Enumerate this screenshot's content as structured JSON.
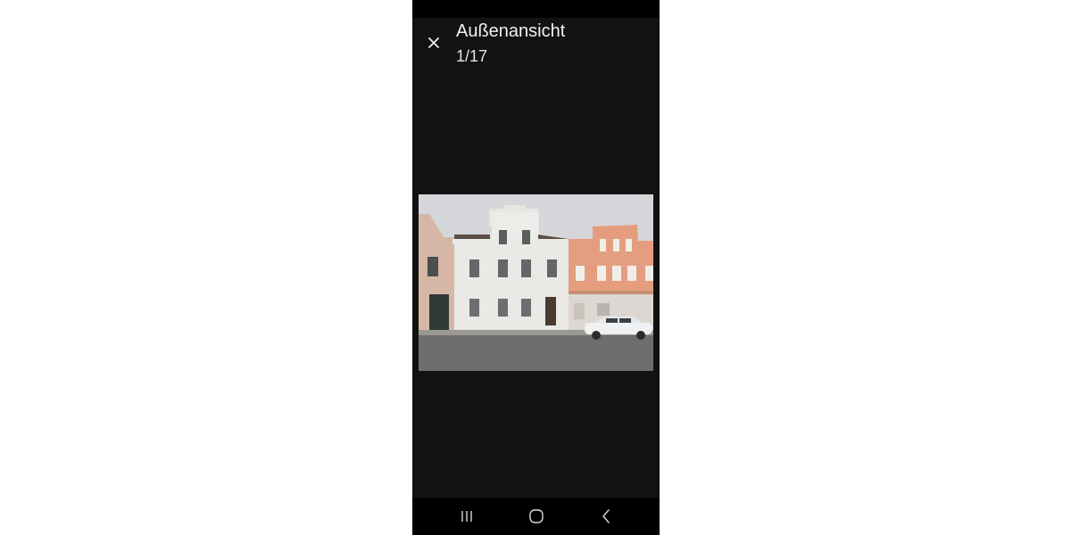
{
  "viewer": {
    "title": "Außenansicht",
    "counter": "1/17"
  },
  "icons": {
    "close": "close-icon",
    "recents": "recent-apps-icon",
    "home": "home-icon",
    "back": "back-icon"
  },
  "colors": {
    "background": "#121212",
    "system_bars": "#000000",
    "text": "#f2f2f2"
  },
  "photo": {
    "description_label": "exterior-photo"
  }
}
